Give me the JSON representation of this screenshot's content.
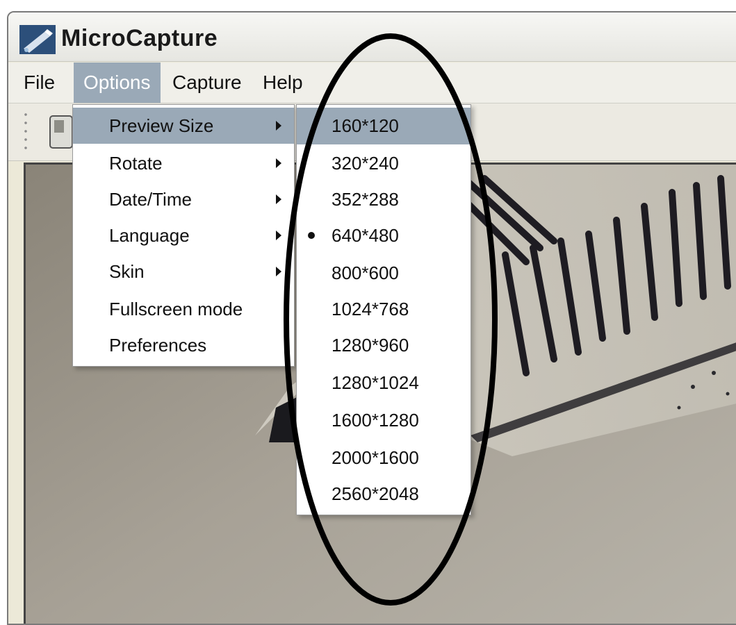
{
  "window": {
    "title": "MicroCapture",
    "icon": "microscope-app-icon"
  },
  "menubar": {
    "items": [
      {
        "label": "File"
      },
      {
        "label": "Options",
        "active": true
      },
      {
        "label": "Capture"
      },
      {
        "label": "Help"
      }
    ]
  },
  "toolbar": {
    "icons": [
      "toolbar-grip-icon",
      "capture-device-icon"
    ]
  },
  "options_menu": {
    "items": [
      {
        "label": "Preview Size",
        "submenu": true,
        "highlighted": true
      },
      {
        "label": "Rotate",
        "submenu": true
      },
      {
        "label": "Date/Time",
        "submenu": true
      },
      {
        "label": "Language",
        "submenu": true
      },
      {
        "label": "Skin",
        "submenu": true
      },
      {
        "label": "Fullscreen mode",
        "submenu": false
      },
      {
        "label": "Preferences",
        "submenu": false
      }
    ]
  },
  "preview_size_menu": {
    "items": [
      {
        "label": "160*120",
        "highlighted": true
      },
      {
        "label": "320*240"
      },
      {
        "label": "352*288"
      },
      {
        "label": "640*480",
        "selected": true
      },
      {
        "label": "800*600"
      },
      {
        "label": "1024*768"
      },
      {
        "label": "1280*960"
      },
      {
        "label": "1280*1024"
      },
      {
        "label": "1600*1280"
      },
      {
        "label": "2000*1600"
      },
      {
        "label": "2560*2048"
      }
    ]
  },
  "colors": {
    "menu_highlight": "#9aa9b7",
    "annotation_stroke": "#000000"
  }
}
